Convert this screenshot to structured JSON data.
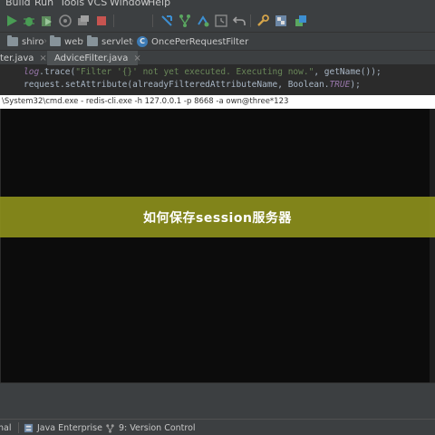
{
  "menu": [
    "Build",
    "Run",
    "Tools",
    "VCS",
    "Window",
    "Help"
  ],
  "toolbar": {
    "icons": [
      "run-icon",
      "debug-icon",
      "coverage-icon",
      "profile-icon",
      "build-icon",
      "stop-icon",
      "vcs-update-icon",
      "vcs-branch-icon",
      "vcs-push-icon",
      "undo-icon",
      "tools-icon",
      "structure-icon",
      "project-structure-icon"
    ]
  },
  "breadcrumb": {
    "items": [
      "shiro",
      "web",
      "servlet",
      "OncePerRequestFilter"
    ]
  },
  "tabs": [
    {
      "label": "ter.java"
    },
    {
      "label": "AdviceFilter.java"
    }
  ],
  "editor": {
    "line1": {
      "obj": "log",
      "call": ".trace(",
      "str": "\"Filter '{}' not yet executed.  Executing now.\"",
      "rest": ", getName());"
    },
    "line2": {
      "call": "request.setAttribute(alreadyFilteredAttributeName, Boolean.",
      "field": "TRUE",
      "rest": ");"
    }
  },
  "cmd": {
    "title": "\\System32\\cmd.exe - redis-cli.exe  -h 127.0.0.1 -p 8668 -a own@three*123"
  },
  "banner": {
    "text": "如何保存session服务器"
  },
  "statusbar": {
    "items": [
      "nal",
      "Java Enterprise",
      "9: Version Control"
    ]
  },
  "colors": {
    "ide_bg": "#3c3f41",
    "editor_bg": "#2b2b2b",
    "cmd_bg": "#0c0c0c",
    "banner": "#8c8f1c",
    "run_green": "#499c54",
    "stop_red": "#c75450"
  }
}
